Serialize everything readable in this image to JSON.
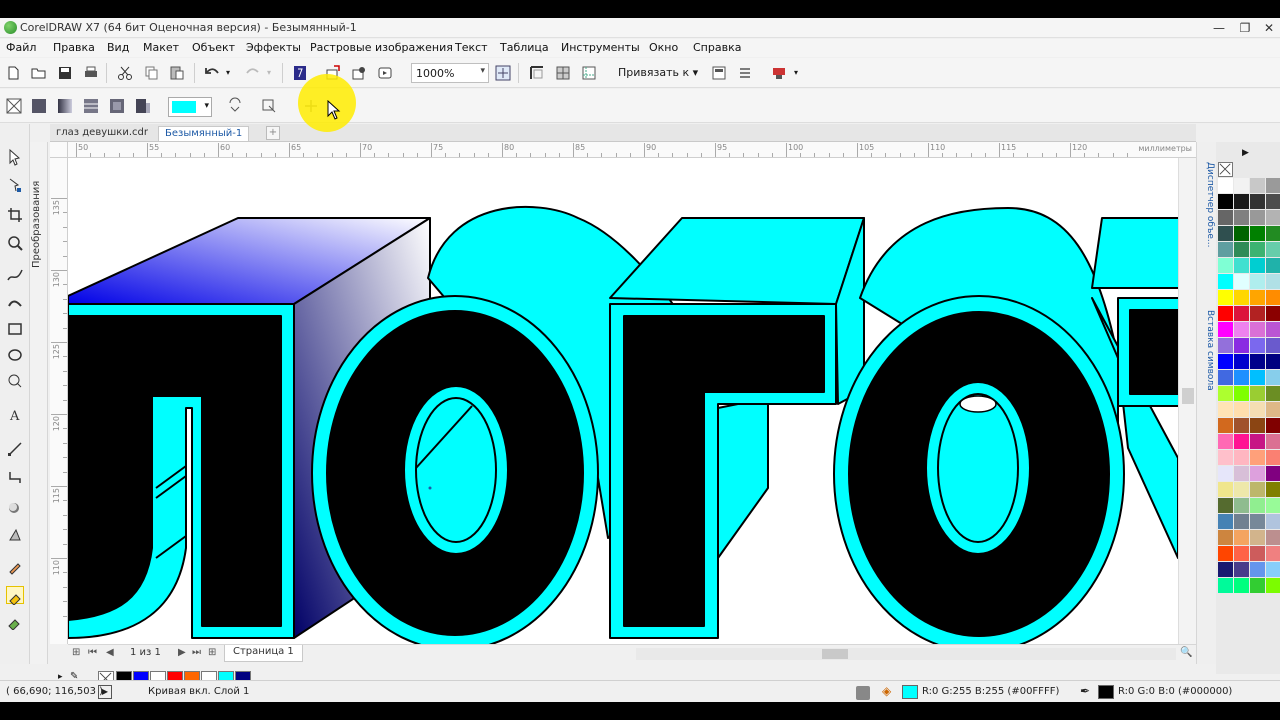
{
  "window": {
    "title": "CorelDRAW X7 (64 бит Оценочная версия) - Безымянный-1",
    "controls": [
      "—",
      "❐",
      "✕"
    ]
  },
  "menu": [
    "Файл",
    "Правка",
    "Вид",
    "Макет",
    "Объект",
    "Эффекты",
    "Растровые изображения",
    "Текст",
    "Таблица",
    "Инструменты",
    "Окно",
    "Справка"
  ],
  "toolbar": {
    "zoom_value": "1000%",
    "snap_label": "Привязать к"
  },
  "property_bar": {
    "fill_color": "#00FFFF"
  },
  "doc_tabs": [
    "глаз девушки.cdr",
    "Безымянный-1"
  ],
  "dockers": [
    "Диспетчер объе...",
    "Вставка символа"
  ],
  "transform_panel": "Преобразования",
  "page_nav": {
    "page_count": "1 из 1",
    "page_tab": "Страница 1"
  },
  "ruler": {
    "h_ticks": [
      "50",
      "55",
      "60",
      "65",
      "70",
      "75",
      "80",
      "85",
      "90",
      "95",
      "100",
      "105",
      "110",
      "115",
      "120"
    ],
    "v_ticks": [
      "135",
      "130",
      "125",
      "120",
      "115",
      "110"
    ],
    "unit": "миллиметры"
  },
  "artwork": {
    "text": "ЛОГОТ",
    "face_color": "#000000",
    "outline_color": "#00FFFF",
    "extrude_color": "#00FFFF",
    "gradient_start": "#0000E6",
    "gradient_end": "#FFFFFF"
  },
  "statusbar": {
    "coords": "( 66,690; 116,503 )",
    "object_info": "Кривая вкл. Слой 1",
    "fill_info": "R:0 G:255 B:255 (#00FFFF)",
    "fill_color": "#00FFFF",
    "outline_info": "R:0 G:0 B:0 (#000000)",
    "outline_color": "#000000"
  },
  "document_palette": [
    "#000000",
    "#0000FF",
    "#FFFFFF",
    "#FF0000",
    "#FF6600",
    "#FFFFFF",
    "#00FFFF",
    "#000080"
  ],
  "palette_colors": [
    "#FFFFFF",
    "#F2F2F2",
    "#C8C8C8",
    "#9A9A9A",
    "#000000",
    "#1A1A1A",
    "#333333",
    "#4D4D4D",
    "#666666",
    "#808080",
    "#999999",
    "#B3B3B3",
    "#2F4F4F",
    "#006400",
    "#008000",
    "#228B22",
    "#5F9EA0",
    "#2E8B57",
    "#3CB371",
    "#66CDAA",
    "#7FFFD4",
    "#40E0D0",
    "#00CED1",
    "#20B2AA",
    "#00FFFF",
    "#E0FFFF",
    "#AFEEEE",
    "#B0E0E6",
    "#FFFF00",
    "#FFD700",
    "#FFA500",
    "#FF8C00",
    "#FF0000",
    "#DC143C",
    "#B22222",
    "#8B0000",
    "#FF00FF",
    "#EE82EE",
    "#DA70D6",
    "#BA55D3",
    "#9370DB",
    "#8A2BE2",
    "#7B68EE",
    "#6A5ACD",
    "#0000FF",
    "#0000CD",
    "#00008B",
    "#000080",
    "#4169E1",
    "#1E90FF",
    "#00BFFF",
    "#87CEEB",
    "#ADFF2F",
    "#7FFF00",
    "#9ACD32",
    "#6B8E23",
    "#FFE4B5",
    "#FFDEAD",
    "#F5DEB3",
    "#DEB887",
    "#D2691E",
    "#A0522D",
    "#8B4513",
    "#800000",
    "#FF69B4",
    "#FF1493",
    "#C71585",
    "#DB7093",
    "#FFC0CB",
    "#FFB6C1",
    "#FFA07A",
    "#FA8072",
    "#E6E6FA",
    "#D8BFD8",
    "#DDA0DD",
    "#800080",
    "#F0E68C",
    "#EEE8AA",
    "#BDB76B",
    "#808000",
    "#556B2F",
    "#8FBC8F",
    "#90EE90",
    "#98FB98",
    "#4682B4",
    "#708090",
    "#778899",
    "#B0C4DE",
    "#CD853F",
    "#F4A460",
    "#D2B48C",
    "#BC8F8F",
    "#FF4500",
    "#FF6347",
    "#CD5C5C",
    "#F08080",
    "#191970",
    "#483D8B",
    "#6495ED",
    "#87CEFA",
    "#00FA9A",
    "#00FF7F",
    "#32CD32",
    "#7CFC00"
  ]
}
